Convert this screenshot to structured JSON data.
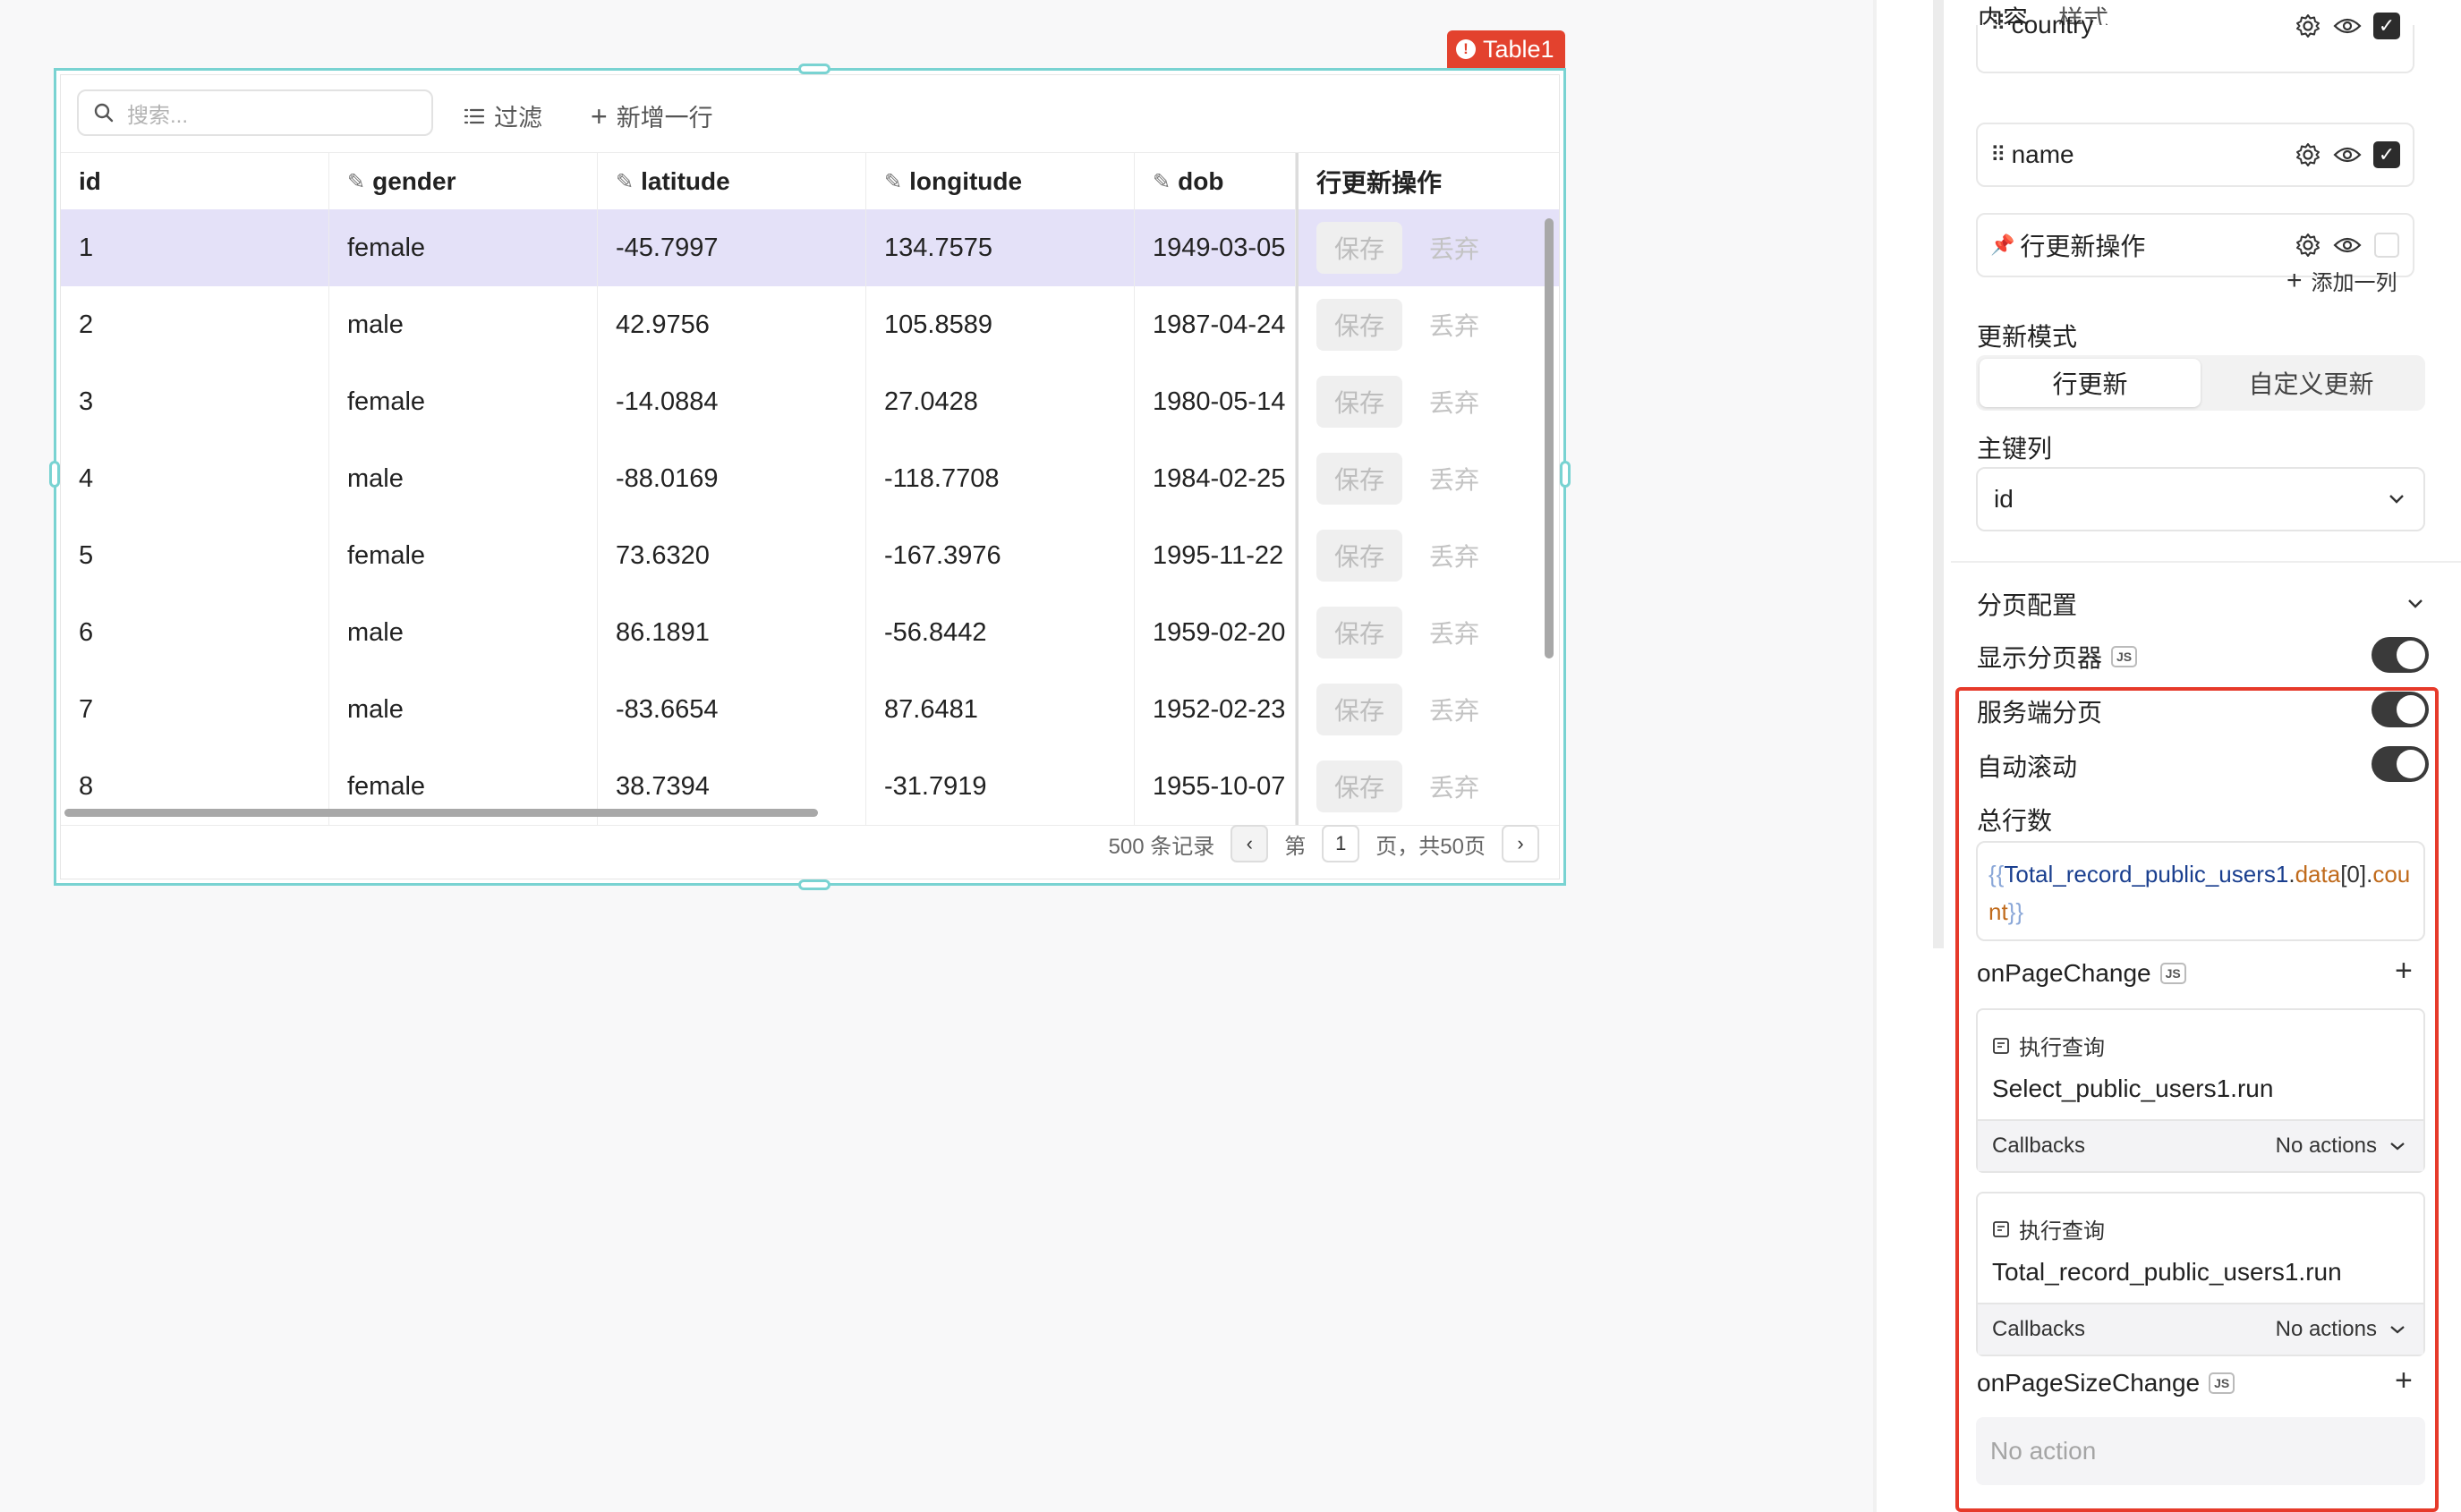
{
  "canvas": {
    "widget_name": "Table1",
    "search_placeholder": "搜索...",
    "filter_label": "过滤",
    "add_row_label": "新增一行",
    "columns": [
      {
        "label": "id",
        "editable": false
      },
      {
        "label": "gender",
        "editable": true
      },
      {
        "label": "latitude",
        "editable": true
      },
      {
        "label": "longitude",
        "editable": true
      },
      {
        "label": "dob",
        "editable": true
      },
      {
        "label": "行更新操作",
        "editable": false
      }
    ],
    "rows": [
      {
        "id": "1",
        "gender": "female",
        "latitude": "-45.7997",
        "longitude": "134.7575",
        "dob": "1949-03-05"
      },
      {
        "id": "2",
        "gender": "male",
        "latitude": "42.9756",
        "longitude": "105.8589",
        "dob": "1987-04-24"
      },
      {
        "id": "3",
        "gender": "female",
        "latitude": "-14.0884",
        "longitude": "27.0428",
        "dob": "1980-05-14"
      },
      {
        "id": "4",
        "gender": "male",
        "latitude": "-88.0169",
        "longitude": "-118.7708",
        "dob": "1984-02-25"
      },
      {
        "id": "5",
        "gender": "female",
        "latitude": "73.6320",
        "longitude": "-167.3976",
        "dob": "1995-11-22"
      },
      {
        "id": "6",
        "gender": "male",
        "latitude": "86.1891",
        "longitude": "-56.8442",
        "dob": "1959-02-20"
      },
      {
        "id": "7",
        "gender": "male",
        "latitude": "-83.6654",
        "longitude": "87.6481",
        "dob": "1952-02-23"
      },
      {
        "id": "8",
        "gender": "female",
        "latitude": "38.7394",
        "longitude": "-31.7919",
        "dob": "1955-10-07"
      }
    ],
    "row_actions": {
      "save": "保存",
      "discard": "丢弃"
    },
    "pager": {
      "records": "500 条记录",
      "page_prefix": "第",
      "current_page": "1",
      "page_suffix": "页，共50页"
    }
  },
  "panel": {
    "tabs": [
      "内容",
      "样式"
    ],
    "column_items": [
      {
        "label": "country",
        "pinned": false,
        "checked": true
      },
      {
        "label": "name",
        "pinned": false,
        "checked": true
      },
      {
        "label": "行更新操作",
        "pinned": true,
        "checked": false
      }
    ],
    "add_column": "添加一列",
    "update_mode_label": "更新模式",
    "update_modes": [
      "行更新",
      "自定义更新"
    ],
    "primary_key_label": "主键列",
    "primary_key_value": "id",
    "pagination_title": "分页配置",
    "show_pager_label": "显示分页器",
    "server_pagination_label": "服务端分页",
    "auto_scroll_label": "自动滚动",
    "total_rows_label": "总行数",
    "total_rows_code": {
      "open": "{{",
      "name": "Total_record_public_users1",
      "dot": ".",
      "prop": "data",
      "index": "[0]",
      "dot2": ".",
      "field": "count",
      "close": "}}"
    },
    "js_badge": "JS",
    "on_page_change_label": "onPageChange",
    "actions": [
      {
        "kind": "执行查询",
        "query": "Select_public_users1.run",
        "callbacks_label": "Callbacks",
        "callbacks_value": "No actions"
      },
      {
        "kind": "执行查询",
        "query": "Total_record_public_users1.run",
        "callbacks_label": "Callbacks",
        "callbacks_value": "No actions"
      }
    ],
    "on_page_size_change_label": "onPageSizeChange",
    "no_action": "No action"
  },
  "colors": {
    "accent_teal": "#79d3d2",
    "error_red": "#e3422e",
    "selected_row": "#e4e1f8",
    "toggle_on": "#3a3a3a"
  }
}
